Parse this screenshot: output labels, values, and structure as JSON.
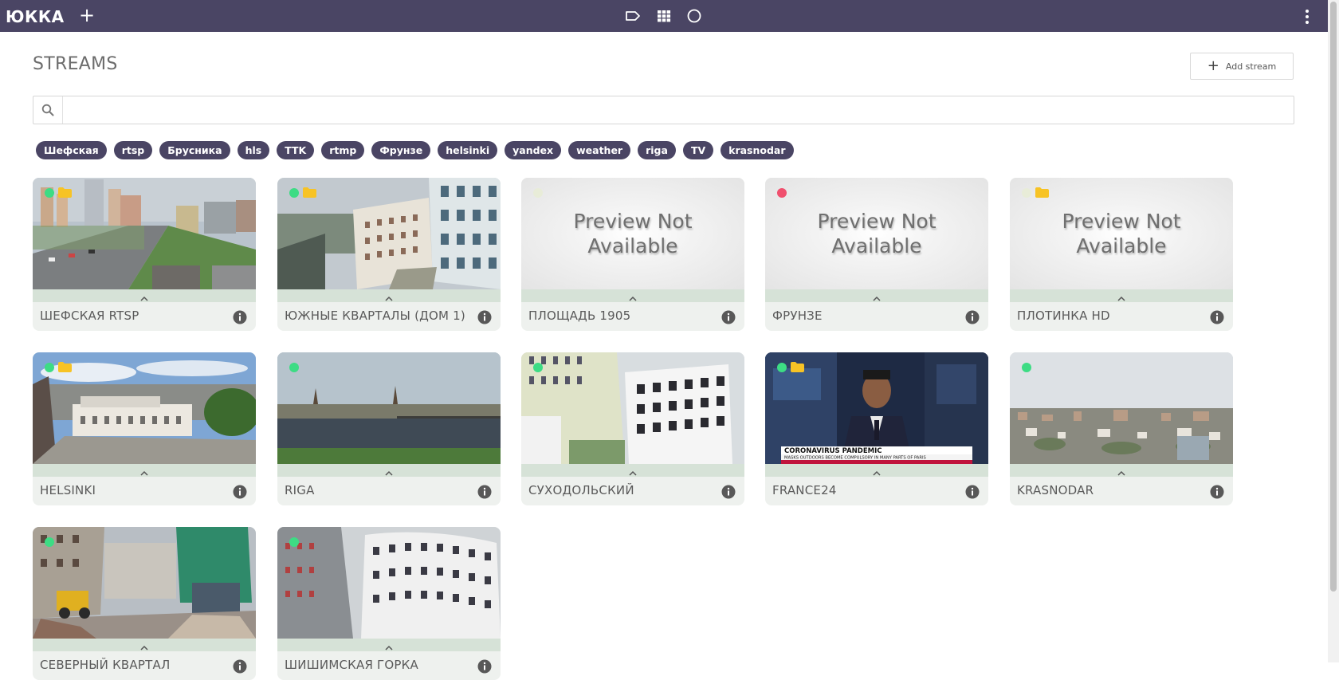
{
  "app": {
    "logo_text": "ЮККА"
  },
  "header": {
    "title": "STREAMS",
    "add_stream_label": "Add stream"
  },
  "search": {
    "value": "",
    "placeholder": ""
  },
  "tags": [
    "Шефская",
    "rtsp",
    "Брусника",
    "hls",
    "TTK",
    "rtmp",
    "Фрунзе",
    "helsinki",
    "yandex",
    "weather",
    "riga",
    "TV",
    "krasnodar"
  ],
  "preview_unavailable_text": [
    "Preview Not",
    "Available"
  ],
  "colors": {
    "topbar": "#4a4564",
    "status_online": "#3ddc84",
    "status_offline": "#f0506e",
    "status_unknown": "#e8ecd8",
    "folder": "#f7c325"
  },
  "streams": [
    {
      "title": "ШЕФСКАЯ RTSP",
      "status": "online",
      "folder": true,
      "preview": "city-street"
    },
    {
      "title": "ЮЖНЫЕ КВАРТАЛЫ (ДОМ 1)",
      "status": "online",
      "folder": true,
      "preview": "building-courtyard"
    },
    {
      "title": "ПЛОЩАДЬ 1905",
      "status": "unknown",
      "folder": false,
      "preview": "none"
    },
    {
      "title": "ФРУНЗЕ",
      "status": "offline",
      "folder": false,
      "preview": "none"
    },
    {
      "title": "ПЛОТИНКА HD",
      "status": "unknown",
      "folder": true,
      "preview": "none"
    },
    {
      "title": "HELSINKI",
      "status": "online",
      "folder": true,
      "preview": "square"
    },
    {
      "title": "RIGA",
      "status": "online",
      "folder": false,
      "preview": "river"
    },
    {
      "title": "СУХОДОЛЬСКИЙ",
      "status": "online",
      "folder": false,
      "preview": "buildings-white"
    },
    {
      "title": "FRANCE24",
      "status": "online",
      "folder": true,
      "preview": "news"
    },
    {
      "title": "KRASNODAR",
      "status": "online",
      "folder": false,
      "preview": "panorama"
    },
    {
      "title": "СЕВЕРНЫЙ КВАРТАЛ",
      "status": "online",
      "folder": false,
      "preview": "construction"
    },
    {
      "title": "ШИШИМСКАЯ ГОРКА",
      "status": "online",
      "folder": false,
      "preview": "buildings-curved"
    }
  ],
  "news_ticker": {
    "headline": "CORONAVIRUS PANDEMIC",
    "subline": "MASKS OUTDOORS BECOME COMPULSORY IN MANY PARTS OF PARIS"
  }
}
